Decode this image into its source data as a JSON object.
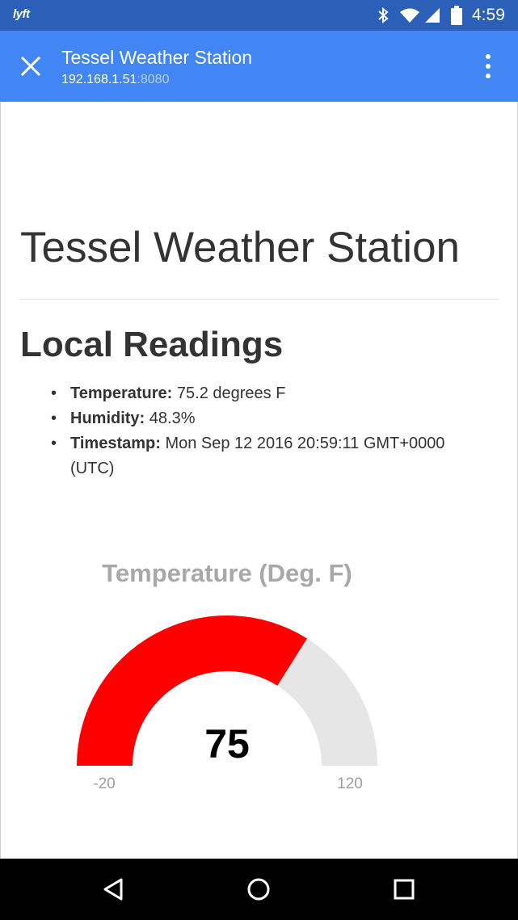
{
  "status_bar": {
    "carrier_logo": "lyft",
    "time": "4:59",
    "icons": [
      "bluetooth-icon",
      "wifi-icon",
      "cell-signal-icon",
      "battery-icon"
    ]
  },
  "app_bar": {
    "title": "Tessel Weather Station",
    "url_host": "192.168.1.51",
    "url_port": ":8080",
    "color": "#4285f4",
    "icons": [
      "close-icon",
      "more-vert-icon"
    ]
  },
  "page": {
    "title": "Tessel Weather Station",
    "section_title": "Local Readings",
    "readings": [
      {
        "label": "Temperature:",
        "value": " 75.2 degrees F"
      },
      {
        "label": "Humidity:",
        "value": " 48.3%"
      },
      {
        "label": "Timestamp:",
        "value": " Mon Sep 12 2016 20:59:11 GMT+0000 (UTC)"
      }
    ]
  },
  "gauge": {
    "title": "Temperature (Deg. F)",
    "value": 75,
    "value_text": "75",
    "min": -20,
    "max": 120,
    "min_text": "-20",
    "max_text": "120",
    "fill_color": "#ff0000",
    "track_color": "#e6e6e6"
  },
  "nav_bar": {
    "icons": [
      "back-icon",
      "home-icon",
      "recents-icon"
    ]
  }
}
